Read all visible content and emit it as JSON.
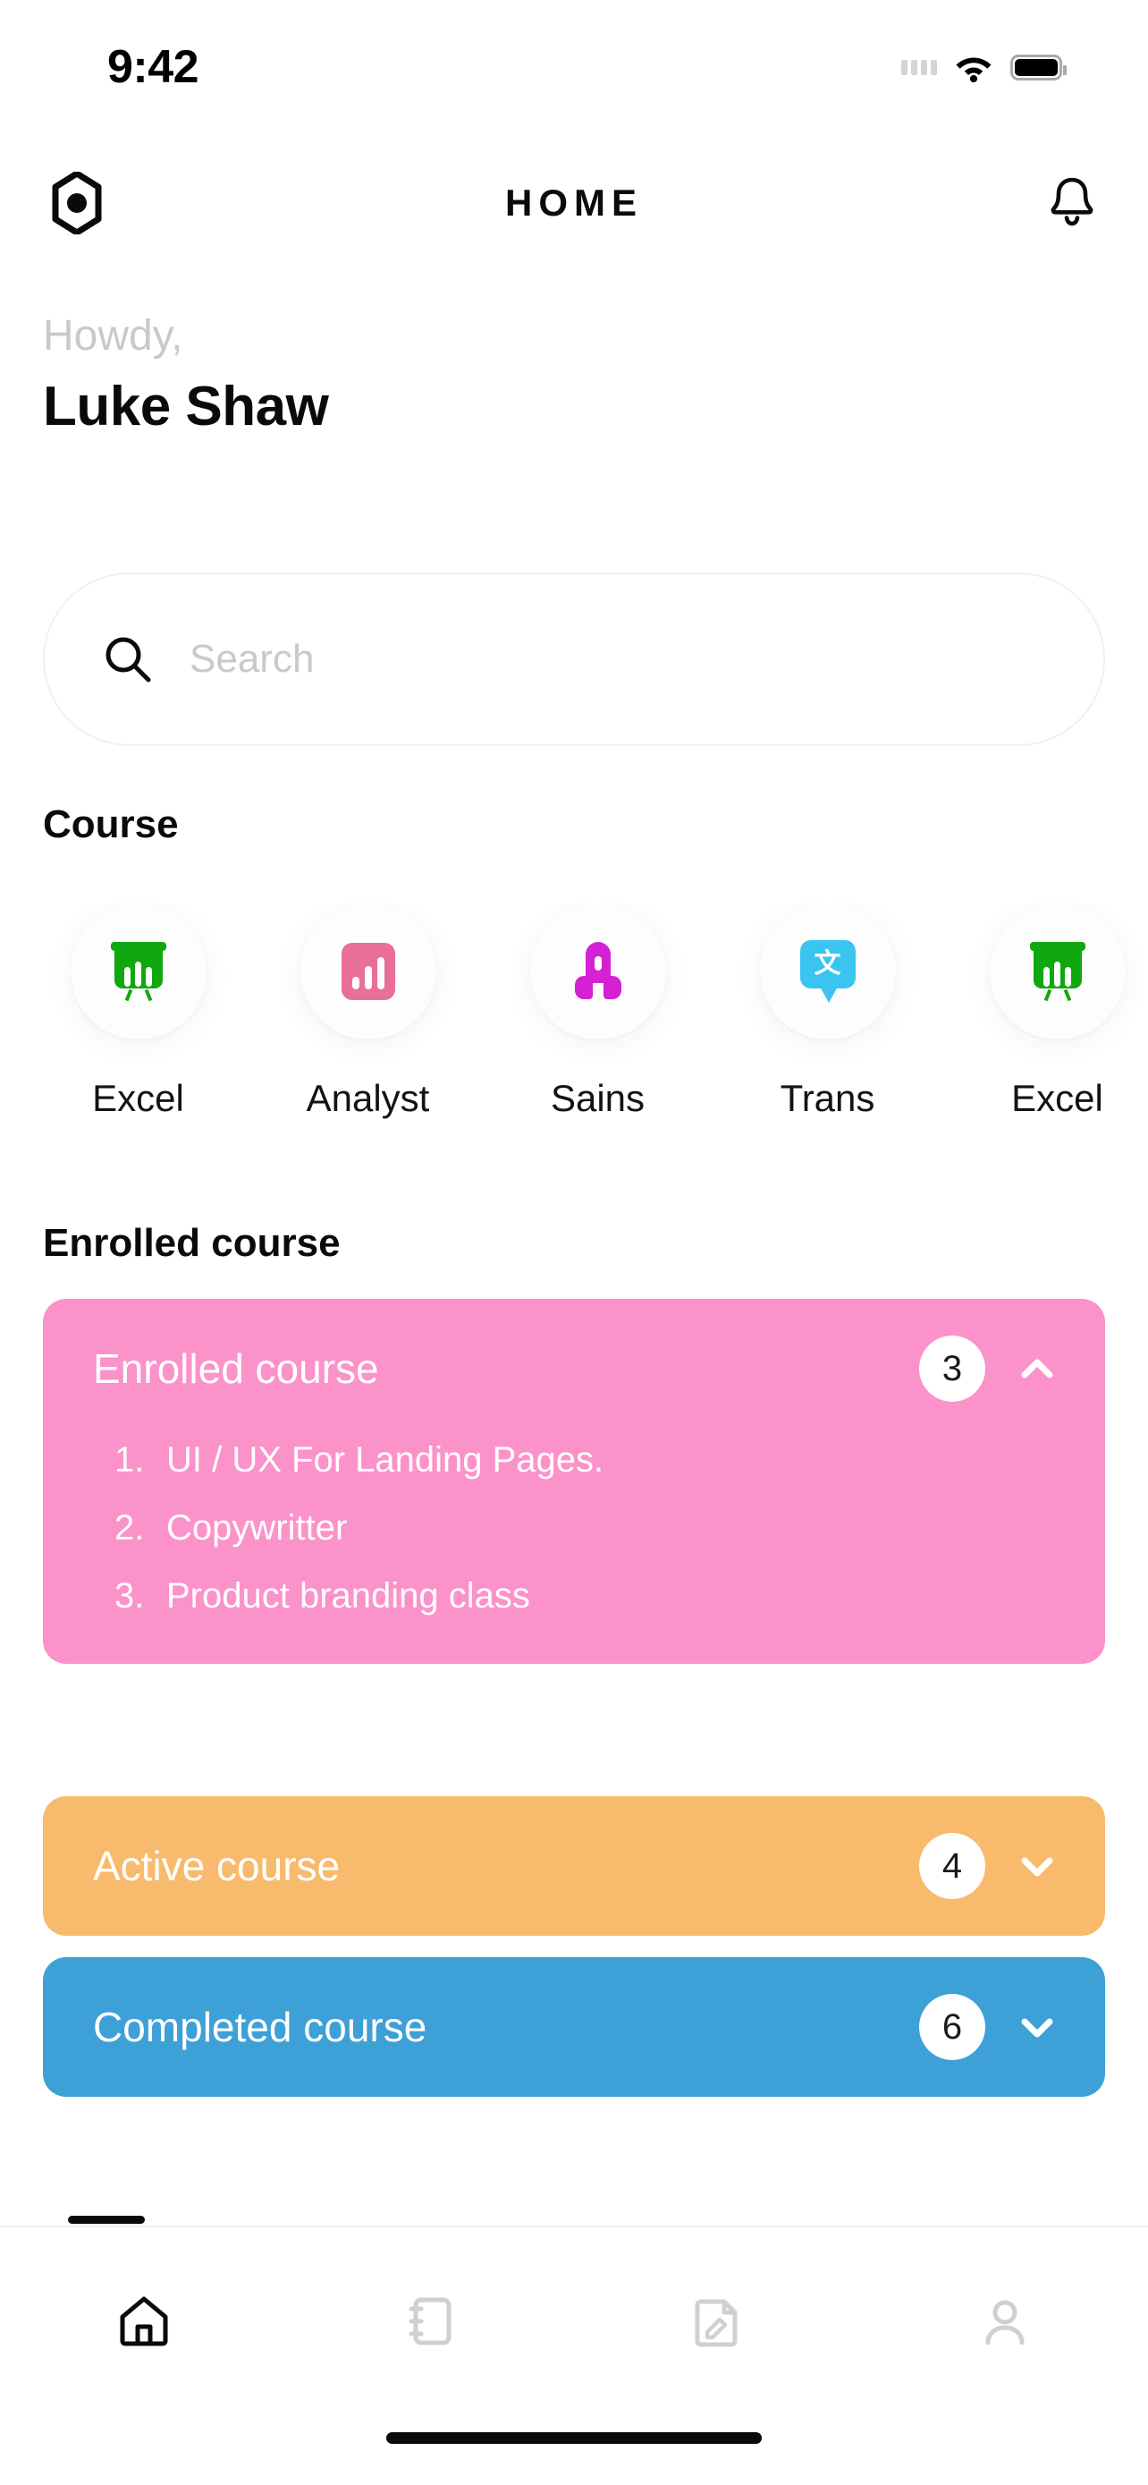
{
  "status_bar": {
    "time": "9:42",
    "icons": [
      "signal-dots-icon",
      "wifi-icon",
      "battery-icon"
    ]
  },
  "header": {
    "logo_icon": "hexagon-logo-icon",
    "title": "HOME",
    "notification_icon": "bell-icon"
  },
  "greeting": {
    "salutation": "Howdy,",
    "name": "Luke Shaw"
  },
  "search": {
    "icon": "search-icon",
    "placeholder": "Search",
    "value": ""
  },
  "course_section": {
    "title": "Course",
    "items": [
      {
        "label": "Excel",
        "icon": "presentation-board-icon",
        "color": "#10A80E"
      },
      {
        "label": "Analyst",
        "icon": "bar-chart-icon",
        "color": "#E86F96"
      },
      {
        "label": "Sains",
        "icon": "rocket-icon",
        "color": "#D321D3"
      },
      {
        "label": "Trans",
        "icon": "translate-icon",
        "color": "#3BC4F0",
        "glyph": "文"
      },
      {
        "label": "Excel",
        "icon": "presentation-board-icon",
        "color": "#10A80E"
      }
    ]
  },
  "enrolled_section": {
    "title": "Enrolled course",
    "cards": [
      {
        "title": "Enrolled course",
        "count": "3",
        "color": "#FB92C9",
        "chevron": "chevron-up-icon",
        "expanded": true,
        "items": [
          {
            "num": "1.",
            "text": "UI / UX For Landing Pages."
          },
          {
            "num": "2.",
            "text": "Copywritter"
          },
          {
            "num": "3.",
            "text": "Product branding class"
          }
        ]
      },
      {
        "title": "Active course",
        "count": "4",
        "color": "#F8BA6C",
        "chevron": "chevron-down-icon",
        "expanded": false,
        "items": []
      },
      {
        "title": "Completed course",
        "count": "6",
        "color": "#3DA0D6",
        "chevron": "chevron-down-icon",
        "expanded": false,
        "items": []
      }
    ]
  },
  "tab_bar": {
    "tabs": [
      {
        "name": "home",
        "icon": "home-icon",
        "active": true
      },
      {
        "name": "bookmark",
        "icon": "book-icon",
        "active": false
      },
      {
        "name": "notes",
        "icon": "note-edit-icon",
        "active": false
      },
      {
        "name": "profile",
        "icon": "person-icon",
        "active": false
      }
    ],
    "active_color": "#0a0a0a",
    "inactive_color": "#cfcfd4"
  }
}
